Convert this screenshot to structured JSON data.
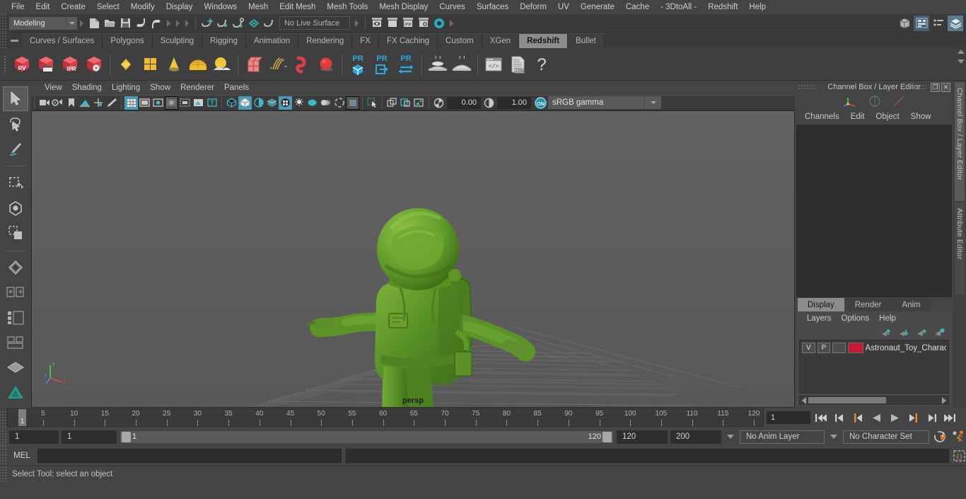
{
  "menubar": {
    "items": [
      "File",
      "Edit",
      "Create",
      "Select",
      "Modify",
      "Display",
      "Windows",
      "Mesh",
      "Edit Mesh",
      "Mesh Tools",
      "Mesh Display",
      "Curves",
      "Surfaces",
      "Deform",
      "UV",
      "Generate",
      "Cache",
      "- 3DtoAll -",
      "Redshift",
      "Help"
    ]
  },
  "statusline": {
    "menuset": "Modeling",
    "live_surface": "No Live Surface",
    "icons": [
      "new-scene-icon",
      "open-scene-icon",
      "save-scene-icon",
      "undo-icon",
      "redo-icon",
      "select-by-hierarchy-icon",
      "select-by-object-icon",
      "select-by-component-icon",
      "snap-to-grid-icon",
      "snap-to-curve-icon",
      "snap-to-point-icon",
      "snap-to-projected-center-icon",
      "snap-to-view-plane-icon",
      "render-view-icon",
      "render-sequence-icon",
      "ipr-render-icon",
      "render-settings-icon",
      "toggle-hypershade-icon"
    ],
    "right_icons": [
      "modeling-toolkit-icon",
      "attribute-editor-icon",
      "tool-settings-icon",
      "channel-box-layer-editor-icon"
    ]
  },
  "shelf": {
    "tabs": [
      "Curves / Surfaces",
      "Polygons",
      "Sculpting",
      "Rigging",
      "Animation",
      "Rendering",
      "FX",
      "FX Caching",
      "Custom",
      "XGen",
      "Redshift",
      "Bullet"
    ],
    "active_tab": "Redshift",
    "buttons": [
      "redshift-render-view-icon",
      "redshift-render-sequence-icon",
      "redshift-ipr-icon",
      "redshift-render-settings-icon",
      "redshift-area-light-icon",
      "redshift-quad-light-icon",
      "redshift-spot-light-icon",
      "redshift-dome-light-icon",
      "redshift-portal-light-icon",
      "redshift-proxy-icon",
      "redshift-hair-icon",
      "redshift-volume-icon",
      "redshift-sphere-icon",
      "redshift-pr-object-icon",
      "redshift-pr-export-icon",
      "redshift-pr-transfer-icon",
      "redshift-bake-icon",
      "redshift-bake-all-icon",
      "redshift-script-icon",
      "redshift-log-icon",
      "redshift-help-icon"
    ]
  },
  "toolbox": {
    "items": [
      "select-tool-icon",
      "lasso-select-tool-icon",
      "paint-select-tool-icon",
      "move-tool-icon",
      "rotate-tool-icon",
      "scale-tool-icon",
      "last-tool-icon",
      "single-perspective-view-icon",
      "four-view-layout-icon",
      "persp-outliner-layout-icon",
      "persp-graph-layout-icon",
      "hypershade-layout-icon",
      "maya-home-icon"
    ]
  },
  "viewport": {
    "panel_menus": [
      "View",
      "Shading",
      "Lighting",
      "Show",
      "Renderer",
      "Panels"
    ],
    "camera_label": "persp",
    "exposure_value": "0.00",
    "gamma_value": "1.00",
    "color_management": "sRGB gamma",
    "toolbar_icons": [
      "select-camera-icon",
      "camera-attributes-icon",
      "bookmark-icon",
      "image-plane-icon",
      "two-d-pan-zoom-icon",
      "grease-pencil-icon",
      "grid-toggle-icon",
      "film-gate-icon",
      "resolution-gate-icon",
      "gate-mask-icon",
      "film-origin-icon",
      "safe-action-icon",
      "text-overlay-icon",
      "wireframe-icon",
      "smooth-shade-all-icon",
      "shade-x-ray-icon",
      "textured-icon",
      "use-all-lights-icon",
      "shadows-icon",
      "screen-space-ao-icon",
      "motion-blur-icon",
      "multisample-icon",
      "depth-of-field-icon",
      "xray-joints-icon",
      "isolate-select-icon",
      "paint-effects-icon",
      "image-based-lighting-icon",
      "hardware-texturing-icon",
      "exposure-icon",
      "gamma-icon",
      "color-management-toggle-icon"
    ]
  },
  "channel_box": {
    "title": "Channel Box / Layer Editor",
    "menus": [
      "Channels",
      "Edit",
      "Object",
      "Show"
    ],
    "axis_icons": [
      "manipulator-axis-icon",
      "circle-manip-icon",
      "line-manip-icon"
    ],
    "window_buttons": [
      "restore-window-icon",
      "close-window-icon"
    ],
    "side_tabs": [
      "Channel Box / Layer Editor",
      "Attribute Editor"
    ]
  },
  "layer_editor": {
    "tabs": [
      "Display",
      "Render",
      "Anim"
    ],
    "active_tab": "Display",
    "menus": [
      "Layers",
      "Options",
      "Help"
    ],
    "buttons": [
      "move-layer-up-icon",
      "move-layer-down-icon",
      "new-layer-icon",
      "new-layer-from-selected-icon"
    ],
    "layers": [
      {
        "visibility": "V",
        "playback": "P",
        "shading": "",
        "color": "#c41a32",
        "name": "Astronaut_Toy_Charac"
      }
    ]
  },
  "timeline": {
    "tick_labels": [
      5,
      10,
      15,
      20,
      25,
      30,
      35,
      40,
      45,
      50,
      55,
      60,
      65,
      70,
      75,
      80,
      85,
      90,
      95,
      100,
      105,
      110,
      115,
      120
    ],
    "current_frame": "1",
    "range_start": "1",
    "range_end": "120",
    "playback_buttons": [
      "go-to-start-icon",
      "step-back-keyframe-icon",
      "step-back-frame-icon",
      "play-backwards-icon",
      "play-forwards-icon",
      "step-forward-frame-icon",
      "step-forward-keyframe-icon",
      "go-to-end-icon"
    ],
    "current_frame_field": "1"
  },
  "range_row": {
    "anim_start": "1",
    "range_start": "1",
    "slider_start_label": "1",
    "slider_end_label": "120",
    "range_end": "120",
    "anim_end": "200",
    "anim_layer": "No Anim Layer",
    "character_set": "No Character Set",
    "buttons": [
      "auto-keyframe-icon",
      "animation-preferences-icon"
    ]
  },
  "command_line": {
    "label": "MEL",
    "input_value": "",
    "script-editor_icon": "script-editor-icon"
  },
  "status_bar": {
    "message": "Select Tool: select an object"
  }
}
